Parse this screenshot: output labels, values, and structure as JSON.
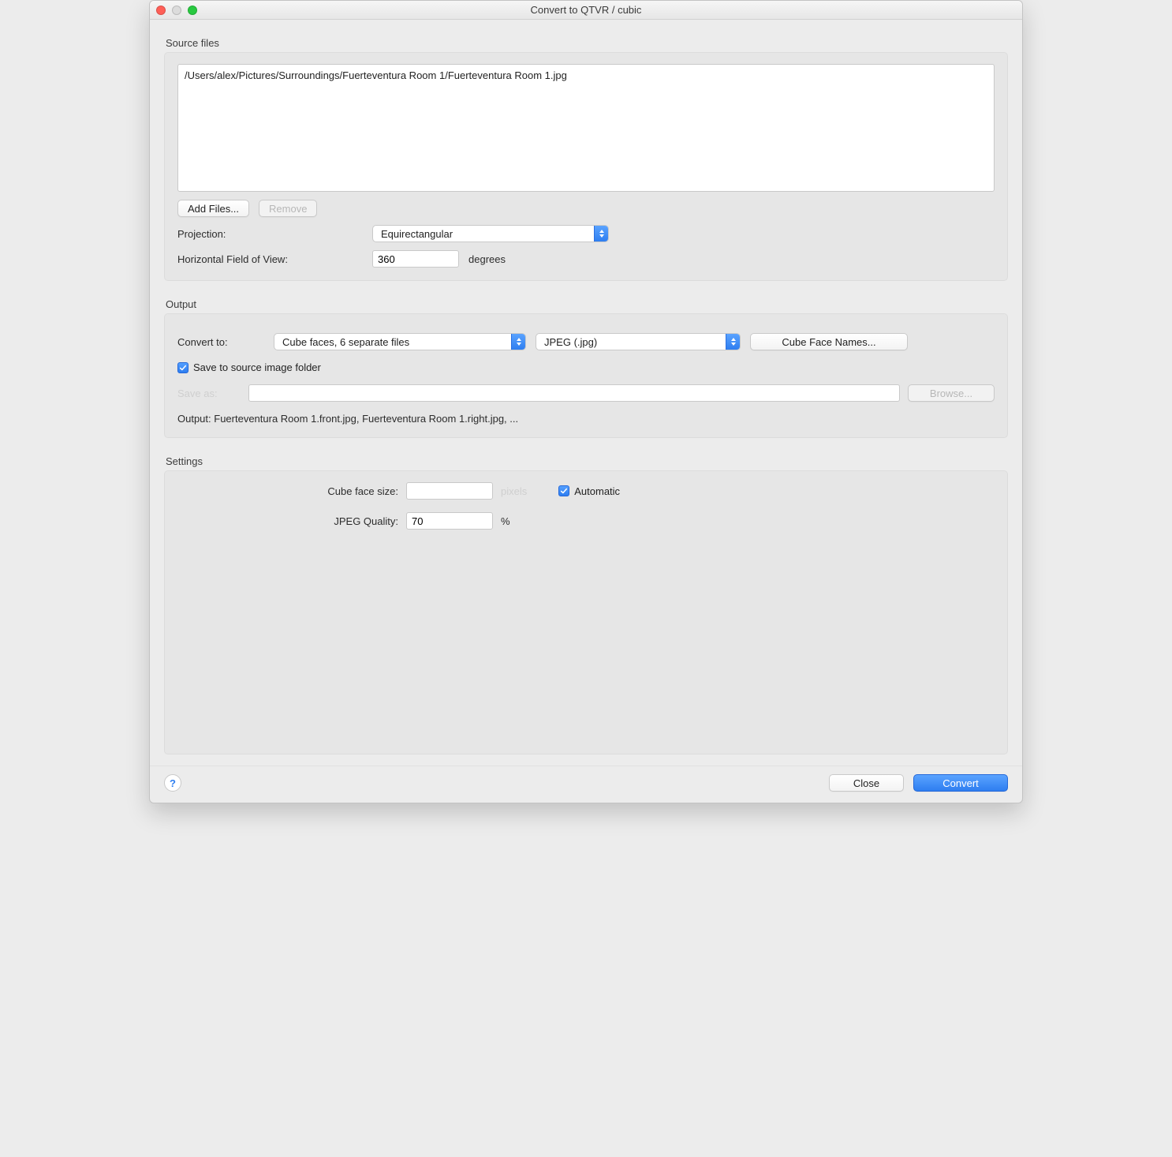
{
  "window_title": "Convert to QTVR / cubic",
  "sections": {
    "source_files": {
      "label": "Source files"
    },
    "output": {
      "label": "Output"
    },
    "settings": {
      "label": "Settings"
    }
  },
  "source": {
    "files": [
      "/Users/alex/Pictures/Surroundings/Fuerteventura Room 1/Fuerteventura Room 1.jpg"
    ],
    "add_files_btn": "Add Files...",
    "remove_btn": "Remove",
    "projection_label": "Projection:",
    "projection_value": "Equirectangular",
    "hfov_label": "Horizontal Field of View:",
    "hfov_value": "360",
    "hfov_units": "degrees"
  },
  "output": {
    "convert_to_label": "Convert to:",
    "convert_to_value": "Cube faces, 6 separate files",
    "format_value": "JPEG (.jpg)",
    "cube_face_names_btn": "Cube Face Names...",
    "save_to_source_label": "Save to source image folder",
    "save_as_label": "Save as:",
    "save_as_value": "",
    "browse_btn": "Browse...",
    "output_line": "Output: Fuerteventura Room 1.front.jpg, Fuerteventura Room 1.right.jpg, ..."
  },
  "settings": {
    "cube_face_size_label": "Cube face size:",
    "cube_face_size_value": "",
    "cube_face_size_units": "pixels",
    "automatic_label": "Automatic",
    "jpeg_quality_label": "JPEG Quality:",
    "jpeg_quality_value": "70",
    "jpeg_quality_units": "%"
  },
  "footer": {
    "close_btn": "Close",
    "convert_btn": "Convert"
  }
}
